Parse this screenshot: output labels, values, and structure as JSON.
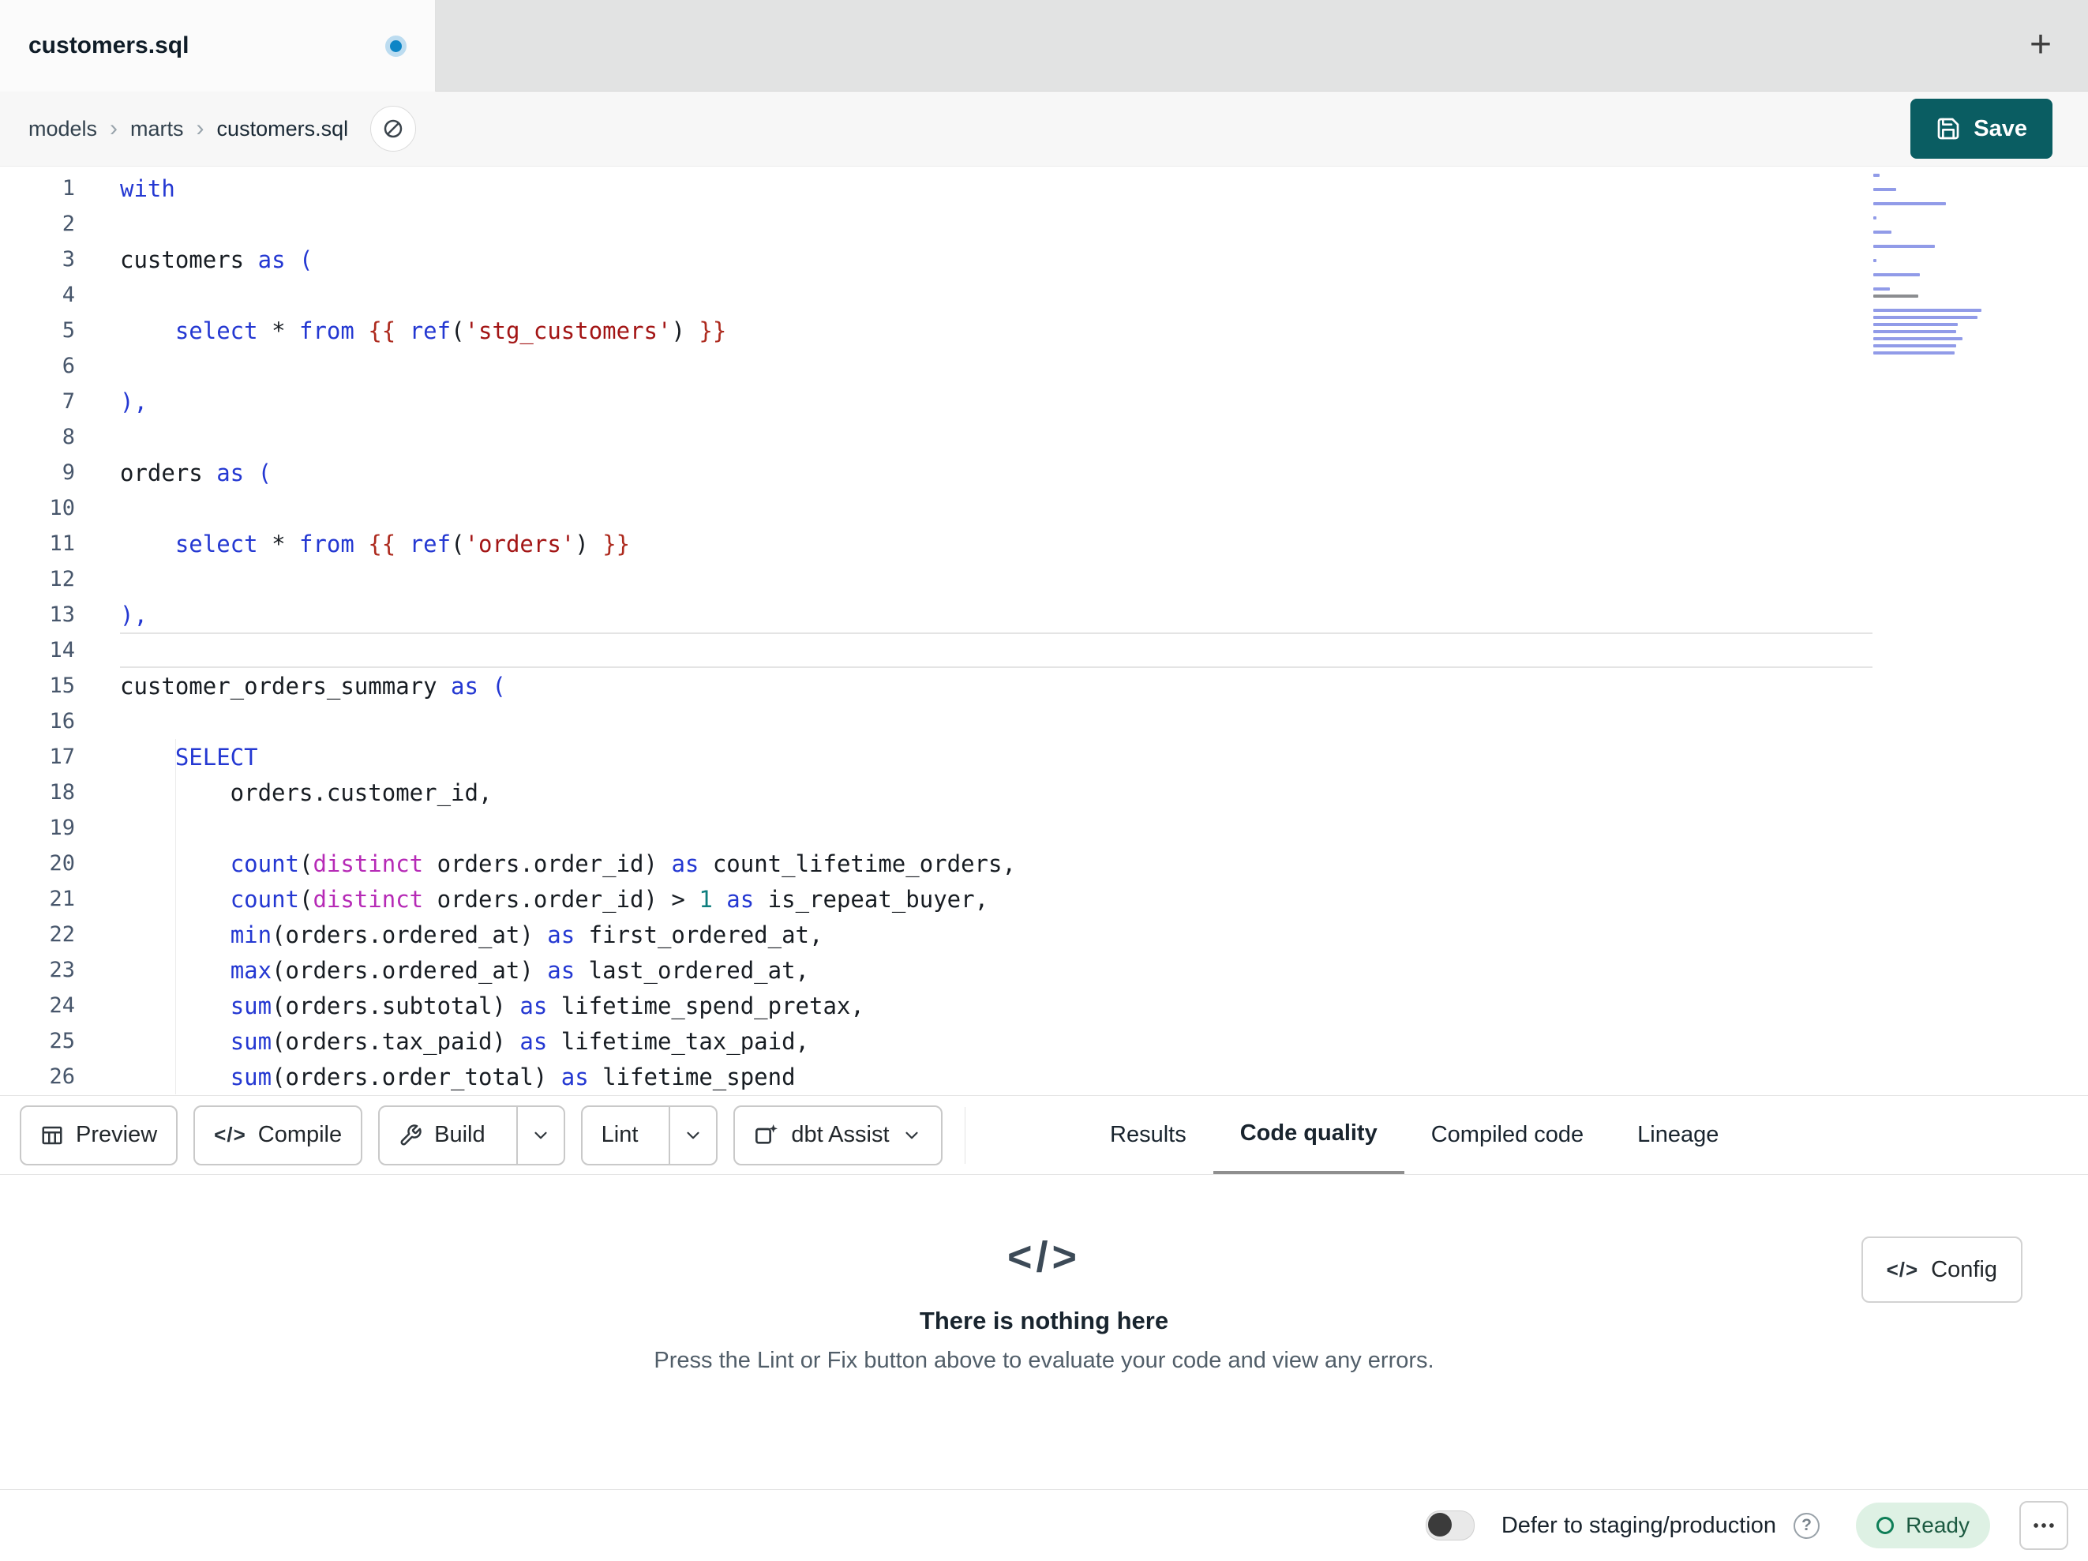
{
  "tab_bar": {
    "active_tab": "customers.sql"
  },
  "breadcrumb": {
    "items": [
      "models",
      "marts",
      "customers.sql"
    ]
  },
  "save": {
    "label": "Save"
  },
  "icons": {
    "new_tab": "+",
    "breadcrumb_separator": "›",
    "compile": "</>",
    "empty_state": "</>",
    "config": "</>",
    "help": "?"
  },
  "toolbar": {
    "preview": "Preview",
    "compile": "Compile",
    "build": "Build",
    "lint": "Lint",
    "assist": "dbt Assist",
    "tabs": [
      {
        "label": "Results",
        "active": false
      },
      {
        "label": "Code quality",
        "active": true
      },
      {
        "label": "Compiled code",
        "active": false
      },
      {
        "label": "Lineage",
        "active": false
      }
    ]
  },
  "results_panel": {
    "title": "There is nothing here",
    "subtitle": "Press the Lint or Fix button above to evaluate your code and view any errors.",
    "config_label": "Config"
  },
  "status_bar": {
    "defer_label": "Defer to staging/production",
    "ready_label": "Ready"
  },
  "colors": {
    "save_button_bg": "#0a5d62",
    "unsaved_dot": "#0d85c6",
    "ready_badge_bg": "#def1e4",
    "ready_icon": "#0e7e57",
    "active_tab_underline": "#8f8f8f",
    "syntax": {
      "keyword": "#2438d2",
      "bracket": "#2438d2",
      "jinja": "#ad2a1e",
      "string": "#a31515",
      "distinct": "#b62ab6",
      "number": "#0e7e7e",
      "plain": "#171c22",
      "line_number": "#47566b"
    }
  },
  "editor": {
    "current_line": 14,
    "lines": [
      {
        "tokens": [
          [
            "kw",
            "with"
          ]
        ]
      },
      {
        "tokens": []
      },
      {
        "tokens": [
          [
            "pl",
            "customers "
          ],
          [
            "kw",
            "as"
          ],
          [
            "pl",
            " "
          ],
          [
            "br",
            "("
          ]
        ]
      },
      {
        "tokens": []
      },
      {
        "tokens": [
          [
            "pl",
            "    "
          ],
          [
            "kw",
            "select"
          ],
          [
            "pl",
            " * "
          ],
          [
            "kw",
            "from"
          ],
          [
            "pl",
            " "
          ],
          [
            "jinja",
            "{{"
          ],
          [
            "pl",
            " "
          ],
          [
            "kw",
            "ref"
          ],
          [
            "pl",
            "("
          ],
          [
            "str",
            "'stg_customers'"
          ],
          [
            "pl",
            ")"
          ],
          [
            "pl",
            " "
          ],
          [
            "jinja",
            "}}"
          ]
        ]
      },
      {
        "tokens": []
      },
      {
        "tokens": [
          [
            "br",
            "),"
          ]
        ]
      },
      {
        "tokens": []
      },
      {
        "tokens": [
          [
            "pl",
            "orders "
          ],
          [
            "kw",
            "as"
          ],
          [
            "pl",
            " "
          ],
          [
            "br",
            "("
          ]
        ]
      },
      {
        "tokens": []
      },
      {
        "tokens": [
          [
            "pl",
            "    "
          ],
          [
            "kw",
            "select"
          ],
          [
            "pl",
            " * "
          ],
          [
            "kw",
            "from"
          ],
          [
            "pl",
            " "
          ],
          [
            "jinja",
            "{{"
          ],
          [
            "pl",
            " "
          ],
          [
            "kw",
            "ref"
          ],
          [
            "pl",
            "("
          ],
          [
            "str",
            "'orders'"
          ],
          [
            "pl",
            ")"
          ],
          [
            "pl",
            " "
          ],
          [
            "jinja",
            "}}"
          ]
        ]
      },
      {
        "tokens": []
      },
      {
        "tokens": [
          [
            "br",
            "),"
          ]
        ]
      },
      {
        "tokens": [],
        "current": true
      },
      {
        "tokens": [
          [
            "pl",
            "customer_orders_summary "
          ],
          [
            "kw",
            "as"
          ],
          [
            "pl",
            " "
          ],
          [
            "br",
            "("
          ]
        ]
      },
      {
        "tokens": []
      },
      {
        "tokens": [
          [
            "pl",
            "    "
          ],
          [
            "kw",
            "SELECT"
          ]
        ]
      },
      {
        "tokens": [
          [
            "pl",
            "        orders.customer_id,"
          ]
        ]
      },
      {
        "tokens": []
      },
      {
        "tokens": [
          [
            "pl",
            "        "
          ],
          [
            "kw",
            "count"
          ],
          [
            "pl",
            "("
          ],
          [
            "mag",
            "distinct"
          ],
          [
            "pl",
            " orders.order_id) "
          ],
          [
            "kw",
            "as"
          ],
          [
            "pl",
            " count_lifetime_orders,"
          ]
        ]
      },
      {
        "tokens": [
          [
            "pl",
            "        "
          ],
          [
            "kw",
            "count"
          ],
          [
            "pl",
            "("
          ],
          [
            "mag",
            "distinct"
          ],
          [
            "pl",
            " orders.order_id) > "
          ],
          [
            "num",
            "1"
          ],
          [
            "pl",
            " "
          ],
          [
            "kw",
            "as"
          ],
          [
            "pl",
            " is_repeat_buyer,"
          ]
        ]
      },
      {
        "tokens": [
          [
            "pl",
            "        "
          ],
          [
            "kw",
            "min"
          ],
          [
            "pl",
            "(orders.ordered_at) "
          ],
          [
            "kw",
            "as"
          ],
          [
            "pl",
            " first_ordered_at,"
          ]
        ]
      },
      {
        "tokens": [
          [
            "pl",
            "        "
          ],
          [
            "kw",
            "max"
          ],
          [
            "pl",
            "(orders.ordered_at) "
          ],
          [
            "kw",
            "as"
          ],
          [
            "pl",
            " last_ordered_at,"
          ]
        ]
      },
      {
        "tokens": [
          [
            "pl",
            "        "
          ],
          [
            "kw",
            "sum"
          ],
          [
            "pl",
            "(orders.subtotal) "
          ],
          [
            "kw",
            "as"
          ],
          [
            "pl",
            " lifetime_spend_pretax,"
          ]
        ]
      },
      {
        "tokens": [
          [
            "pl",
            "        "
          ],
          [
            "kw",
            "sum"
          ],
          [
            "pl",
            "(orders.tax_paid) "
          ],
          [
            "kw",
            "as"
          ],
          [
            "pl",
            " lifetime_tax_paid,"
          ]
        ]
      },
      {
        "tokens": [
          [
            "pl",
            "        "
          ],
          [
            "kw",
            "sum"
          ],
          [
            "pl",
            "(orders.order_total) "
          ],
          [
            "kw",
            "as"
          ],
          [
            "pl",
            " lifetime_spend"
          ]
        ]
      }
    ]
  }
}
